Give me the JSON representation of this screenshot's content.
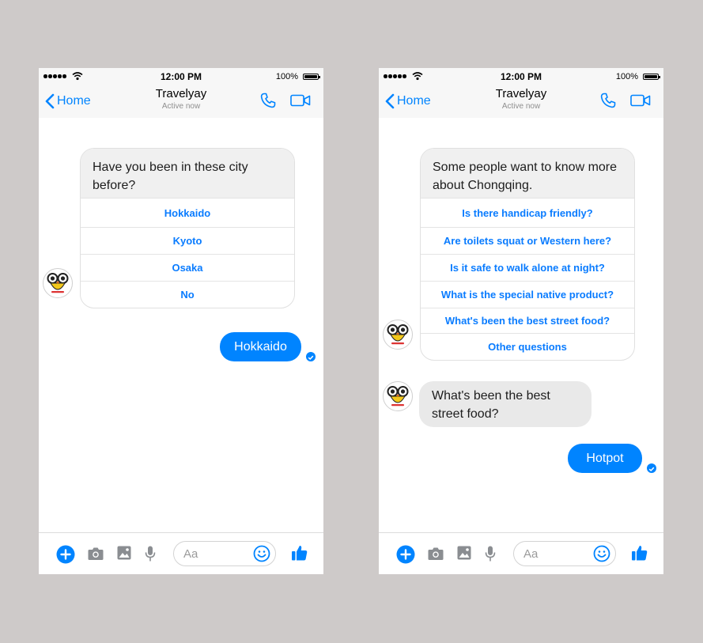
{
  "status_bar": {
    "time": "12:00 PM",
    "battery": "100%"
  },
  "nav": {
    "back_label": "Home",
    "title": "Travelyay",
    "subtitle": "Active now"
  },
  "left": {
    "card": {
      "prompt": "Have you been in these city before?",
      "options": [
        "Hokkaido",
        "Kyoto",
        "Osaka",
        "No"
      ]
    },
    "reply": "Hokkaido"
  },
  "right": {
    "card": {
      "prompt": "Some people want to know more about Chongqing.",
      "options": [
        "Is there handicap friendly?",
        "Are toilets squat or Western here?",
        "Is it safe to walk alone at night?",
        "What is the special native product?",
        "What's been the best street food?",
        "Other questions"
      ]
    },
    "incoming": "What's been the best street food?",
    "reply": "Hotpot"
  },
  "composer": {
    "placeholder": "Aa"
  },
  "icons": [
    "back-chevron-icon",
    "phone-icon",
    "video-camera-icon",
    "plus-icon",
    "camera-icon",
    "image-icon",
    "microphone-icon",
    "emoji-icon",
    "thumbs-up-icon",
    "check-icon",
    "owl-avatar-icon"
  ],
  "colors": {
    "accent": "#0084ff",
    "bubble_in": "#e9e9e9",
    "background": "#cecac9"
  }
}
